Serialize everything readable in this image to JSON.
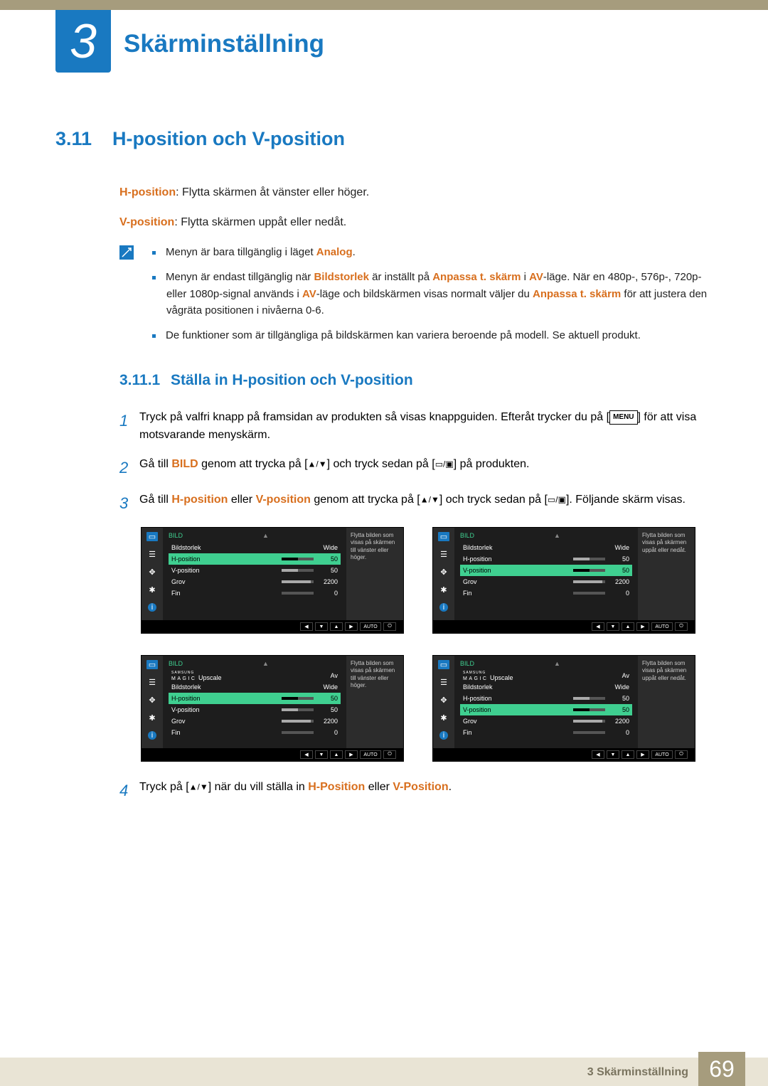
{
  "chapter": {
    "number": "3",
    "title": "Skärminställning"
  },
  "section": {
    "number": "3.11",
    "title": "H-position och V-position"
  },
  "intro": {
    "hpos_label": "H-position",
    "hpos_desc": ": Flytta skärmen åt vänster eller höger.",
    "vpos_label": "V-position",
    "vpos_desc": ": Flytta skärmen uppåt eller nedåt."
  },
  "notes": [
    {
      "pre": "Menyn är bara tillgänglig i läget ",
      "hl": "Analog",
      "post": "."
    },
    {
      "pre": "Menyn är endast tillgänglig när ",
      "hl1": "Bildstorlek",
      "mid1": " är inställt på ",
      "hl2": "Anpassa t. skärm",
      "mid2": " i ",
      "hl3": "AV",
      "mid3": "-läge. När en 480p-, 576p-, 720p- eller 1080p-signal används i ",
      "hl4": "AV",
      "mid4": "-läge och bildskärmen visas normalt väljer du ",
      "hl5": "Anpassa t. skärm",
      "post": " för att justera den vågräta positionen i nivåerna 0-6."
    },
    {
      "text": "De funktioner som är tillgängliga på bildskärmen kan variera beroende på modell. Se aktuell produkt."
    }
  ],
  "subsection": {
    "number": "3.11.1",
    "title": "Ställa in H-position och V-position"
  },
  "steps": {
    "s1": {
      "pre": "Tryck på valfri knapp på framsidan av produkten så visas knappguiden. Efteråt trycker du på [",
      "btn": "MENU",
      "post": "] för att visa motsvarande menyskärm."
    },
    "s2": {
      "pre": "Gå till ",
      "hl": "BILD",
      "post1": " genom att trycka på [",
      "icons1": "▲/▼",
      "post2": "] och tryck sedan på [",
      "icons2": "▭/▣",
      "post3": "] på produkten."
    },
    "s3": {
      "pre": "Gå till ",
      "hl1": "H-position",
      "mid1": " eller ",
      "hl2": "V-position",
      "mid2": " genom att trycka på [",
      "icons1": "▲/▼",
      "mid3": "] och tryck sedan på [",
      "icons2": "▭/▣",
      "post": "]. Följande skärm visas."
    },
    "s4": {
      "pre": "Tryck på [",
      "icons": "▲/▼",
      "mid": "] när du vill ställa in ",
      "hl1": "H-Position",
      "mid2": " eller ",
      "hl2": "V-Position",
      "post": "."
    }
  },
  "osd": {
    "title": "BILD",
    "upscale": "Upscale",
    "upscale_brand_top": "SAMSUNG",
    "upscale_brand": "MAGIC",
    "upscale_val": "Av",
    "rows": {
      "bildstorlek": {
        "label": "Bildstorlek",
        "val": "Wide"
      },
      "hpos": {
        "label": "H-position",
        "val": "50"
      },
      "vpos": {
        "label": "V-position",
        "val": "50"
      },
      "grov": {
        "label": "Grov",
        "val": "2200"
      },
      "fin": {
        "label": "Fin",
        "val": "0"
      }
    },
    "desc_h": "Flytta bilden som visas på skärmen till vänster eller höger.",
    "desc_v": "Flytta bilden som visas på skärmen uppåt eller nedåt.",
    "footer": {
      "auto": "AUTO"
    }
  },
  "footer": {
    "label": "3 Skärminställning",
    "page": "69"
  }
}
